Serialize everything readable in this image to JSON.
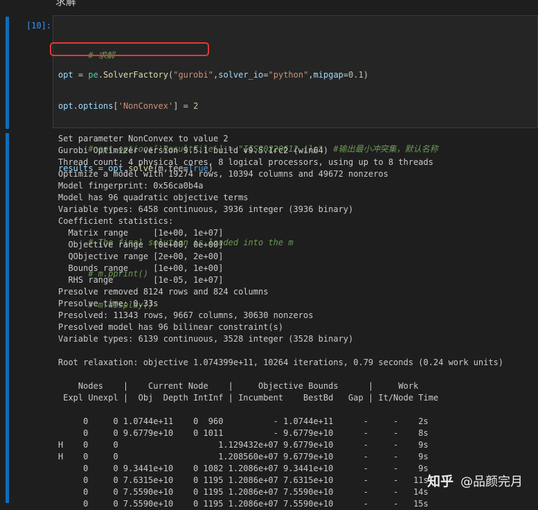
{
  "page_top_fragment": "求解",
  "cell": {
    "prompt": "[10]:",
    "code": {
      "line1_comment": "# 求解",
      "line2": {
        "var": "opt",
        "eq": " = ",
        "obj": "pe",
        "dot": ".",
        "fn": "SolverFactory",
        "open": "(",
        "s1": "\"gurobi\"",
        "comma1": ",",
        "kw1": "solver_io",
        "eq2": "=",
        "s2": "\"python\"",
        "comma2": ",",
        "kw2": "mipgap",
        "eq3": "=",
        "num": "0.1",
        "close": ")"
      },
      "line3": {
        "var": "opt",
        "dot": ".",
        "attr": "options",
        "open": "[",
        "key": "'NonConvex'",
        "close": "]",
        "eq": " = ",
        "num": "2"
      },
      "line4_comment": "# opt.options['ResultFile'] = \"IIS20220612.ilp\"  #输出最小冲突集，默认名称",
      "line5": {
        "var": "results",
        "eq": " = ",
        "obj": "opt",
        "dot": ".",
        "fn": "solve",
        "args_pre": "(m,tee=",
        "bool": "True",
        "close": ")"
      },
      "line6": "",
      "line7_comment": "# The final solution is loaded into the m",
      "line8_comment": "# m.pprint()",
      "line9_comment": "# m.display()"
    }
  },
  "output_lines": [
    "Set parameter NonConvex to value 2",
    "Gurobi Optimizer version 9.5.1 build v9.5.1rc2 (win64)",
    "Thread count: 4 physical cores, 8 logical processors, using up to 8 threads",
    "Optimize a model with 19274 rows, 10394 columns and 49672 nonzeros",
    "Model fingerprint: 0x56ca0b4a",
    "Model has 96 quadratic objective terms",
    "Variable types: 6458 continuous, 3936 integer (3936 binary)",
    "Coefficient statistics:",
    "  Matrix range     [1e+00, 1e+07]",
    "  Objective range  [0e+00, 0e+00]",
    "  QObjective range [2e+00, 2e+00]",
    "  Bounds range     [1e+00, 1e+00]",
    "  RHS range        [1e-05, 1e+07]",
    "Presolve removed 8124 rows and 824 columns",
    "Presolve time: 0.33s",
    "Presolved: 11343 rows, 9667 columns, 30630 nonzeros",
    "Presolved model has 96 bilinear constraint(s)",
    "Variable types: 6139 continuous, 3528 integer (3528 binary)",
    "",
    "Root relaxation: objective 1.074399e+11, 10264 iterations, 0.79 seconds (0.24 work units)",
    "",
    "    Nodes    |    Current Node    |     Objective Bounds      |     Work",
    " Expl Unexpl |  Obj  Depth IntInf | Incumbent    BestBd   Gap | It/Node Time",
    "",
    "     0     0 1.0744e+11    0  960          - 1.0744e+11      -     -    2s",
    "     0     0 9.6779e+10    0 1011          - 9.6779e+10      -     -    8s",
    "H    0     0                    1.129432e+07 9.6779e+10      -     -    9s",
    "H    0     0                    1.208560e+07 9.6779e+10      -     -    9s",
    "     0     0 9.3441e+10    0 1082 1.2086e+07 9.3441e+10      -     -    9s",
    "     0     0 7.6315e+10    0 1195 1.2086e+07 7.6315e+10      -     -   11s",
    "     0     0 7.5590e+10    0 1195 1.2086e+07 7.5590e+10      -     -   14s",
    "     0     0 7.5590e+10    0 1195 1.2086e+07 7.5590e+10      -     -   15s"
  ],
  "watermark": {
    "logo": "知乎",
    "handle": "@品颜完月"
  },
  "colors": {
    "background": "#1e1e1e",
    "cell_bar": "#0e6ebd",
    "highlight": "#e53935",
    "comment": "#6a9955",
    "string": "#ce9178"
  }
}
